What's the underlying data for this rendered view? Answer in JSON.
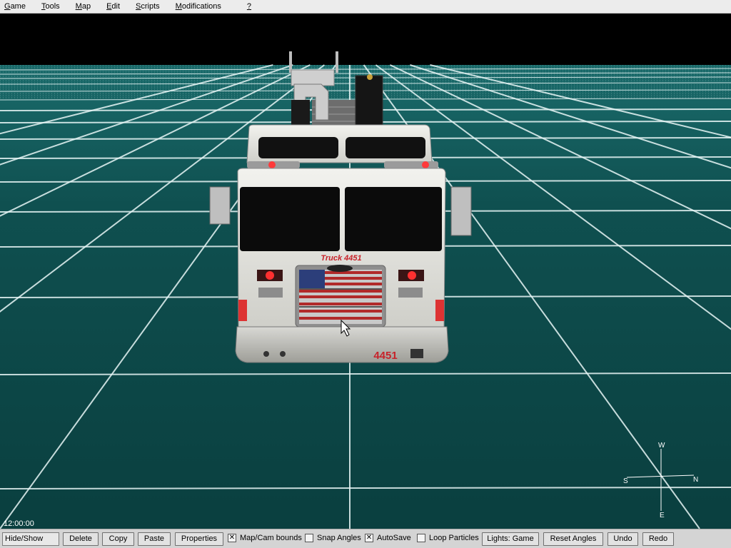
{
  "menu": {
    "items": [
      {
        "mnemonic": "G",
        "rest": "ame"
      },
      {
        "mnemonic": "T",
        "rest": "ools"
      },
      {
        "mnemonic": "M",
        "rest": "ap"
      },
      {
        "mnemonic": "E",
        "rest": "dit"
      },
      {
        "mnemonic": "S",
        "rest": "cripts"
      },
      {
        "mnemonic": "M",
        "rest": "odifications"
      },
      {
        "mnemonic": "?",
        "rest": ""
      }
    ]
  },
  "viewport": {
    "vehicle_text": "Truck 4451",
    "vehicle_number": "4451",
    "grid_color": "#e8f6f6",
    "ground_color": "#0d4a4a",
    "clock": "12:00:00",
    "compass": {
      "north": "N",
      "south": "S",
      "west": "W",
      "east": "E"
    }
  },
  "toolbar": {
    "hide_show": "Hide/Show",
    "delete": "Delete",
    "copy": "Copy",
    "paste": "Paste",
    "properties": "Properties",
    "map_cam_bounds": {
      "label": "Map/Cam bounds",
      "checked": true
    },
    "snap_angles": {
      "label": "Snap Angles",
      "checked": false
    },
    "autosave": {
      "label": "AutoSave",
      "checked": true
    },
    "loop_particles": {
      "label": "Loop Particles",
      "checked": false
    },
    "lights": "Lights: Game",
    "reset_angles": "Reset Angles",
    "undo": "Undo",
    "redo": "Redo"
  }
}
